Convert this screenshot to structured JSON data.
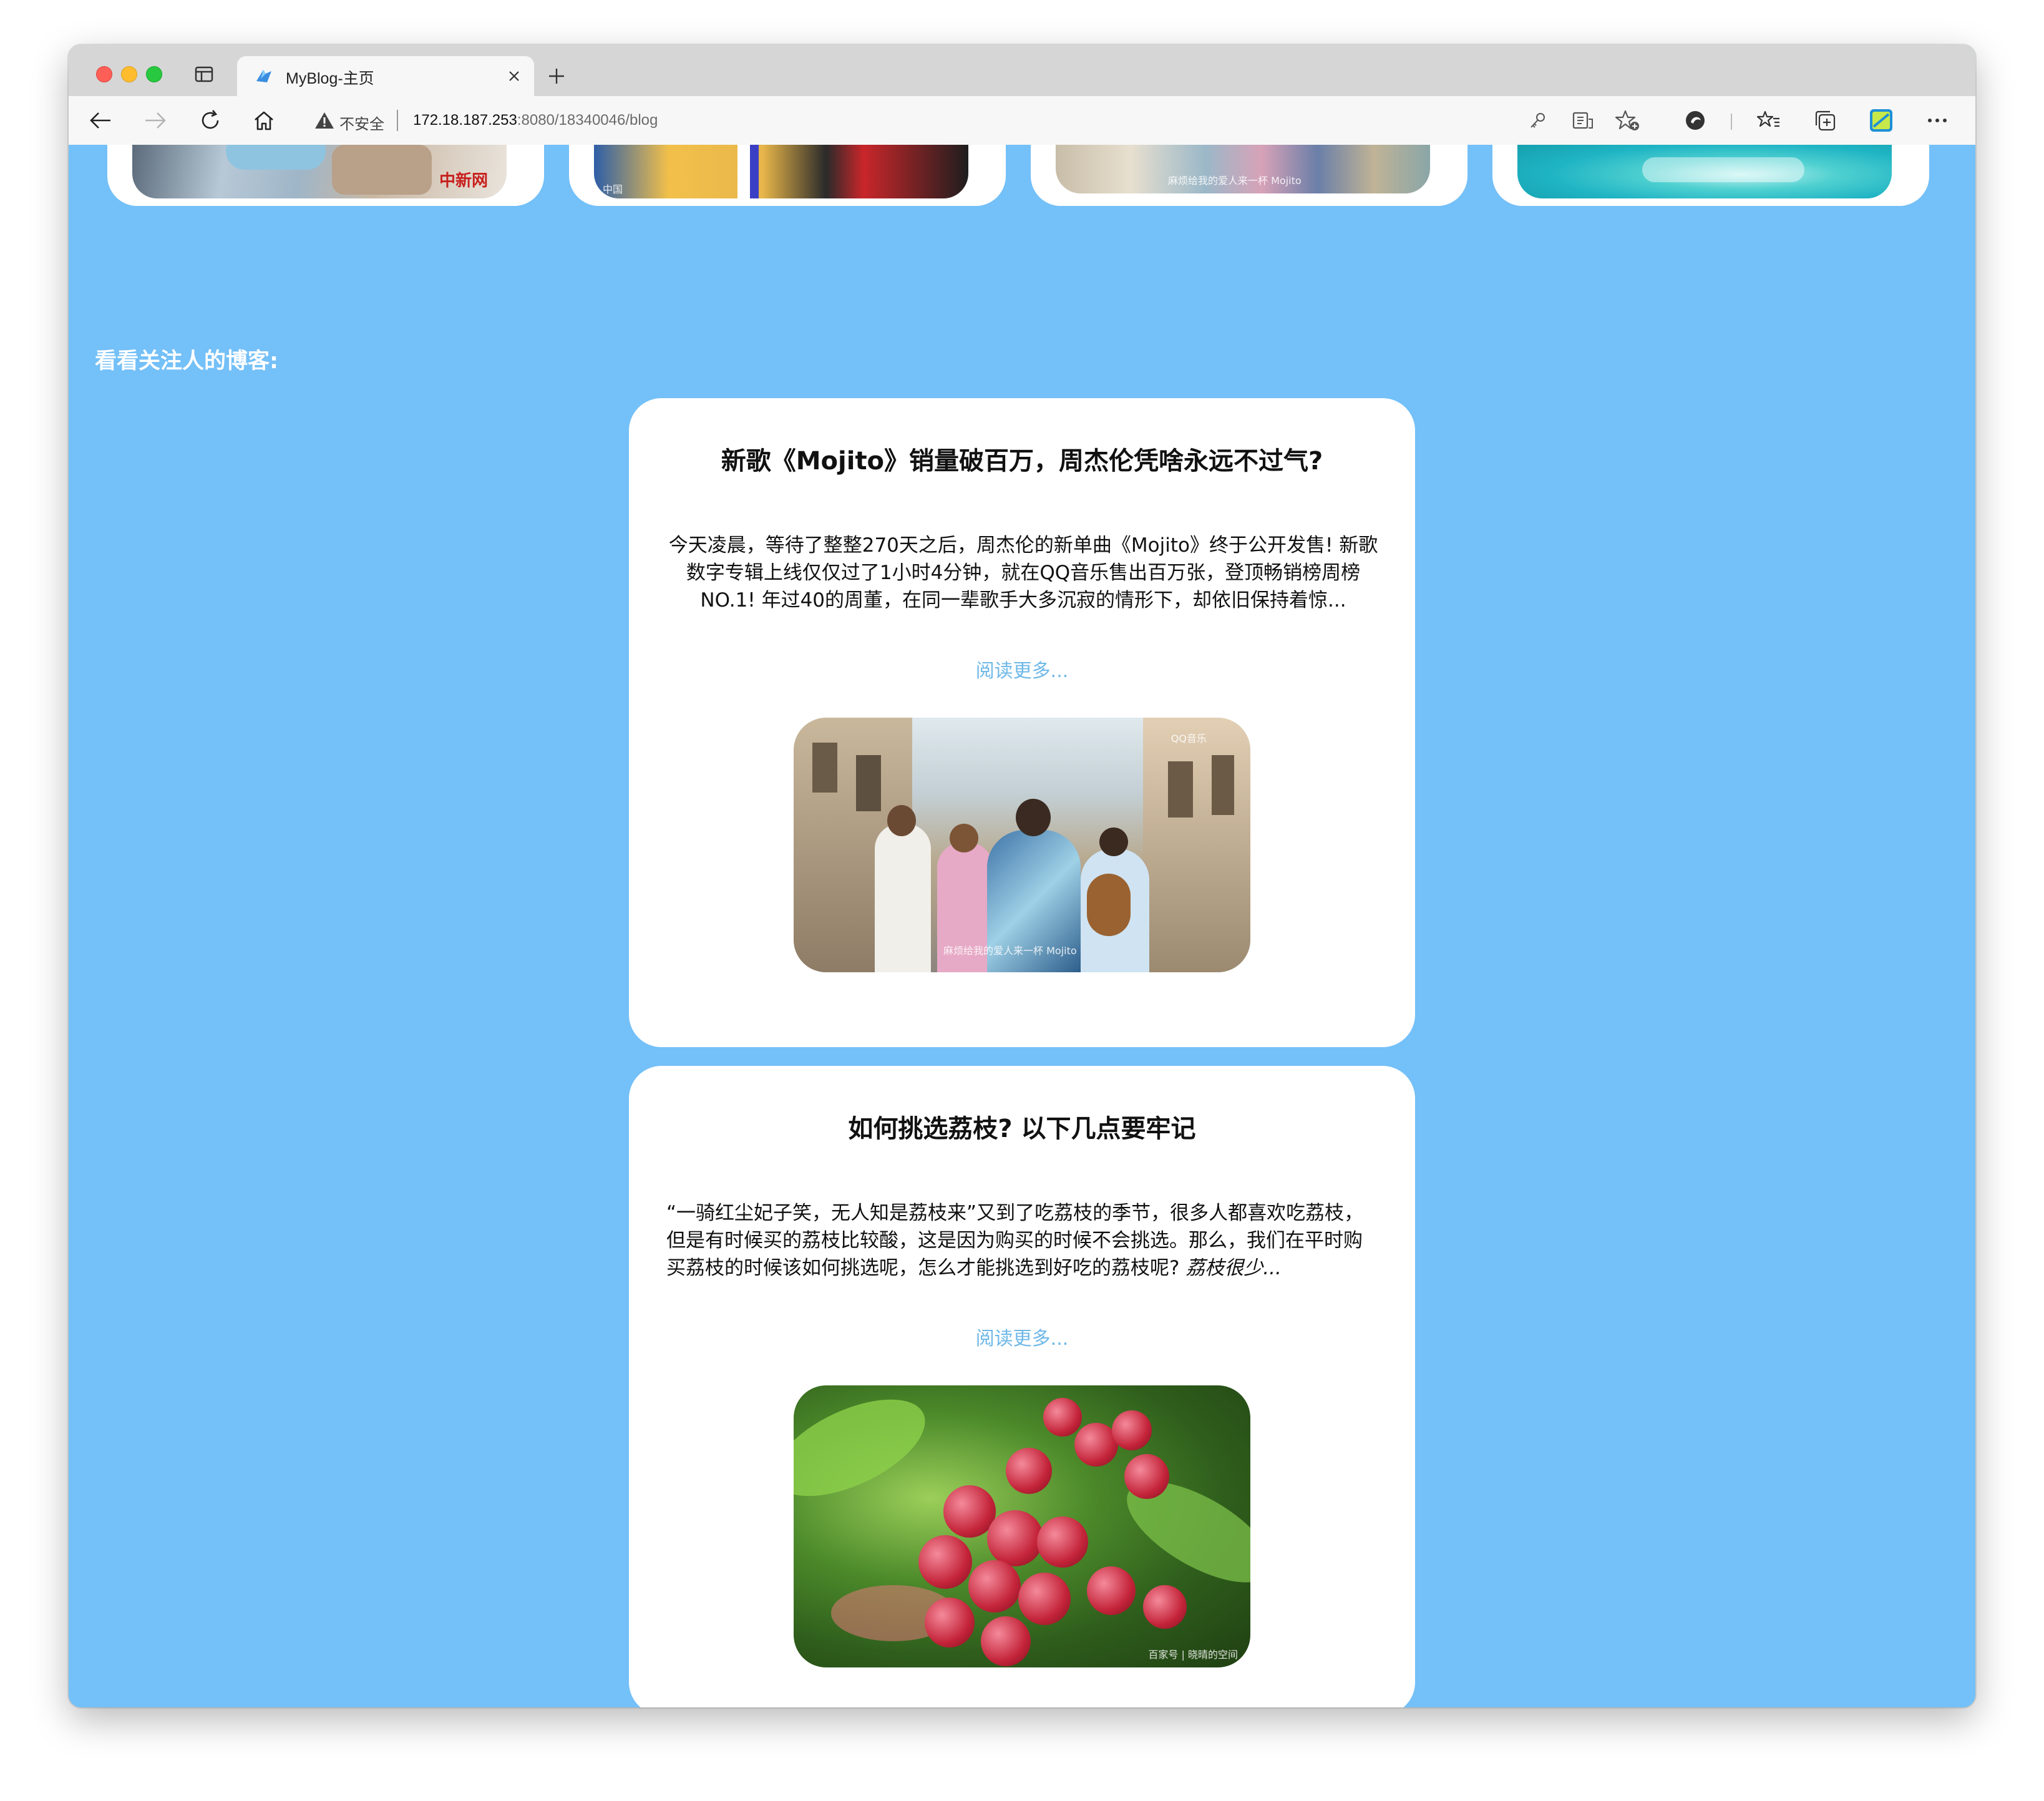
{
  "browser": {
    "tab_title": "MyBlog-主页",
    "insecure_label": "不安全",
    "url_host": "172.18.187.253",
    "url_rest": ":8080/18340046/blog"
  },
  "icons": [
    "sidebar-toggle-icon",
    "edge-favicon-icon",
    "close-icon",
    "plus-icon",
    "back-arrow-icon",
    "forward-arrow-icon",
    "reload-icon",
    "home-icon",
    "warning-icon",
    "key-icon",
    "read-view-icon",
    "add-favorite-icon",
    "tracking-icon",
    "favorites-icon",
    "collections-icon",
    "profile-icon",
    "more-icon"
  ],
  "top_cards": [
    {
      "caption": "中新网"
    },
    {
      "caption": "中国"
    },
    {
      "caption": "麻烦给我的爱人来一杯 Mojito"
    },
    {
      "caption": ""
    }
  ],
  "section": {
    "label": "看看关注人的博客:"
  },
  "posts": [
    {
      "title": "新歌《Mojito》销量破百万，周杰伦凭啥永远不过气?",
      "excerpt": "今天凌晨，等待了整整270天之后，周杰伦的新单曲《Mojito》终于公开发售! 新歌数字专辑上线仅仅过了1小时4分钟，就在QQ音乐售出百万张，登顶畅销榜周榜NO.1! 年过40的周董，在同一辈歌手大多沉寂的情形下，却依旧保持着惊...",
      "read_more": "阅读更多...",
      "image_caption": "麻烦给我的爱人来一杯 Mojito",
      "image_badge": "QQ音乐"
    },
    {
      "title": "如何挑选荔枝? 以下几点要牢记",
      "excerpt": "“一骑红尘妃子笑，无人知是荔枝来”又到了吃荔枝的季节，很多人都喜欢吃荔枝，但是有时候买的荔枝比较酸，这是因为购买的时候不会挑选。那么，我们在平时购买荔枝的时候该如何挑选呢，怎么才能挑选到好吃的荔枝呢?",
      "excerpt_tail": "荔枝很少...",
      "read_more": "阅读更多...",
      "image_caption": "百家号 | 晓晴的空间"
    }
  ],
  "colors": {
    "page_bg": "#74c0f8",
    "card_bg": "#ffffff",
    "link": "#6fb8e8",
    "tabbar": "#d6d6d6"
  }
}
